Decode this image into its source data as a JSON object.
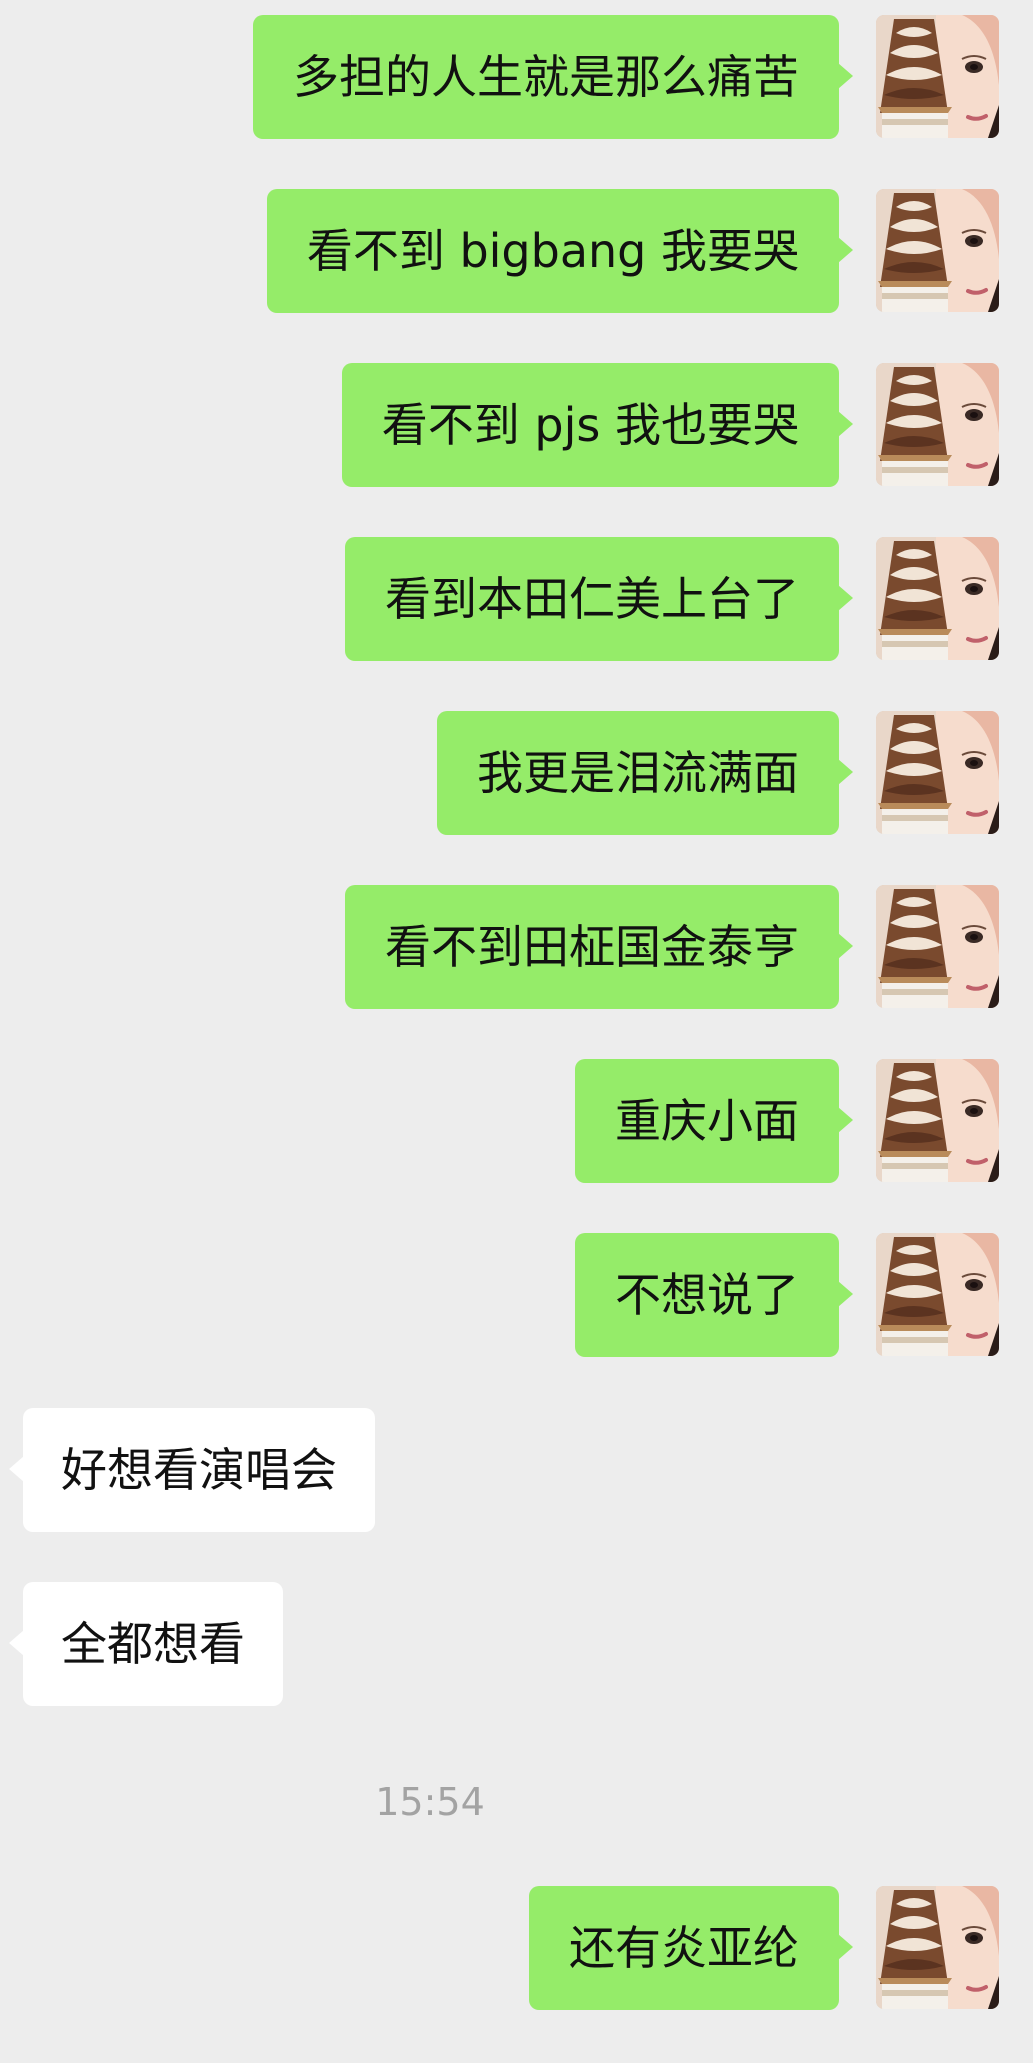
{
  "messages": [
    {
      "from": "me",
      "text": "多担的人生就是那么痛苦"
    },
    {
      "from": "me",
      "text": "看不到 bigbang 我要哭"
    },
    {
      "from": "me",
      "text": "看不到 pjs 我也要哭"
    },
    {
      "from": "me",
      "text": "看到本田仁美上台了"
    },
    {
      "from": "me",
      "text": "我更是泪流满面"
    },
    {
      "from": "me",
      "text": "看不到田柾国金泰亨"
    },
    {
      "from": "me",
      "text": "重庆小面"
    },
    {
      "from": "me",
      "text": "不想说了"
    },
    {
      "from": "other",
      "text": "好想看演唱会"
    },
    {
      "from": "other",
      "text": "全都想看"
    },
    {
      "from": "system",
      "text": "15:54"
    },
    {
      "from": "me",
      "text": "还有炎亚纶"
    }
  ],
  "colors": {
    "background": "#EDEDED",
    "my_bubble": "#95EC69",
    "other_bubble": "#FFFFFF",
    "timestamp": "#A3A3A3"
  },
  "icons": {
    "avatar": "avatar-ice-cream-girl"
  }
}
